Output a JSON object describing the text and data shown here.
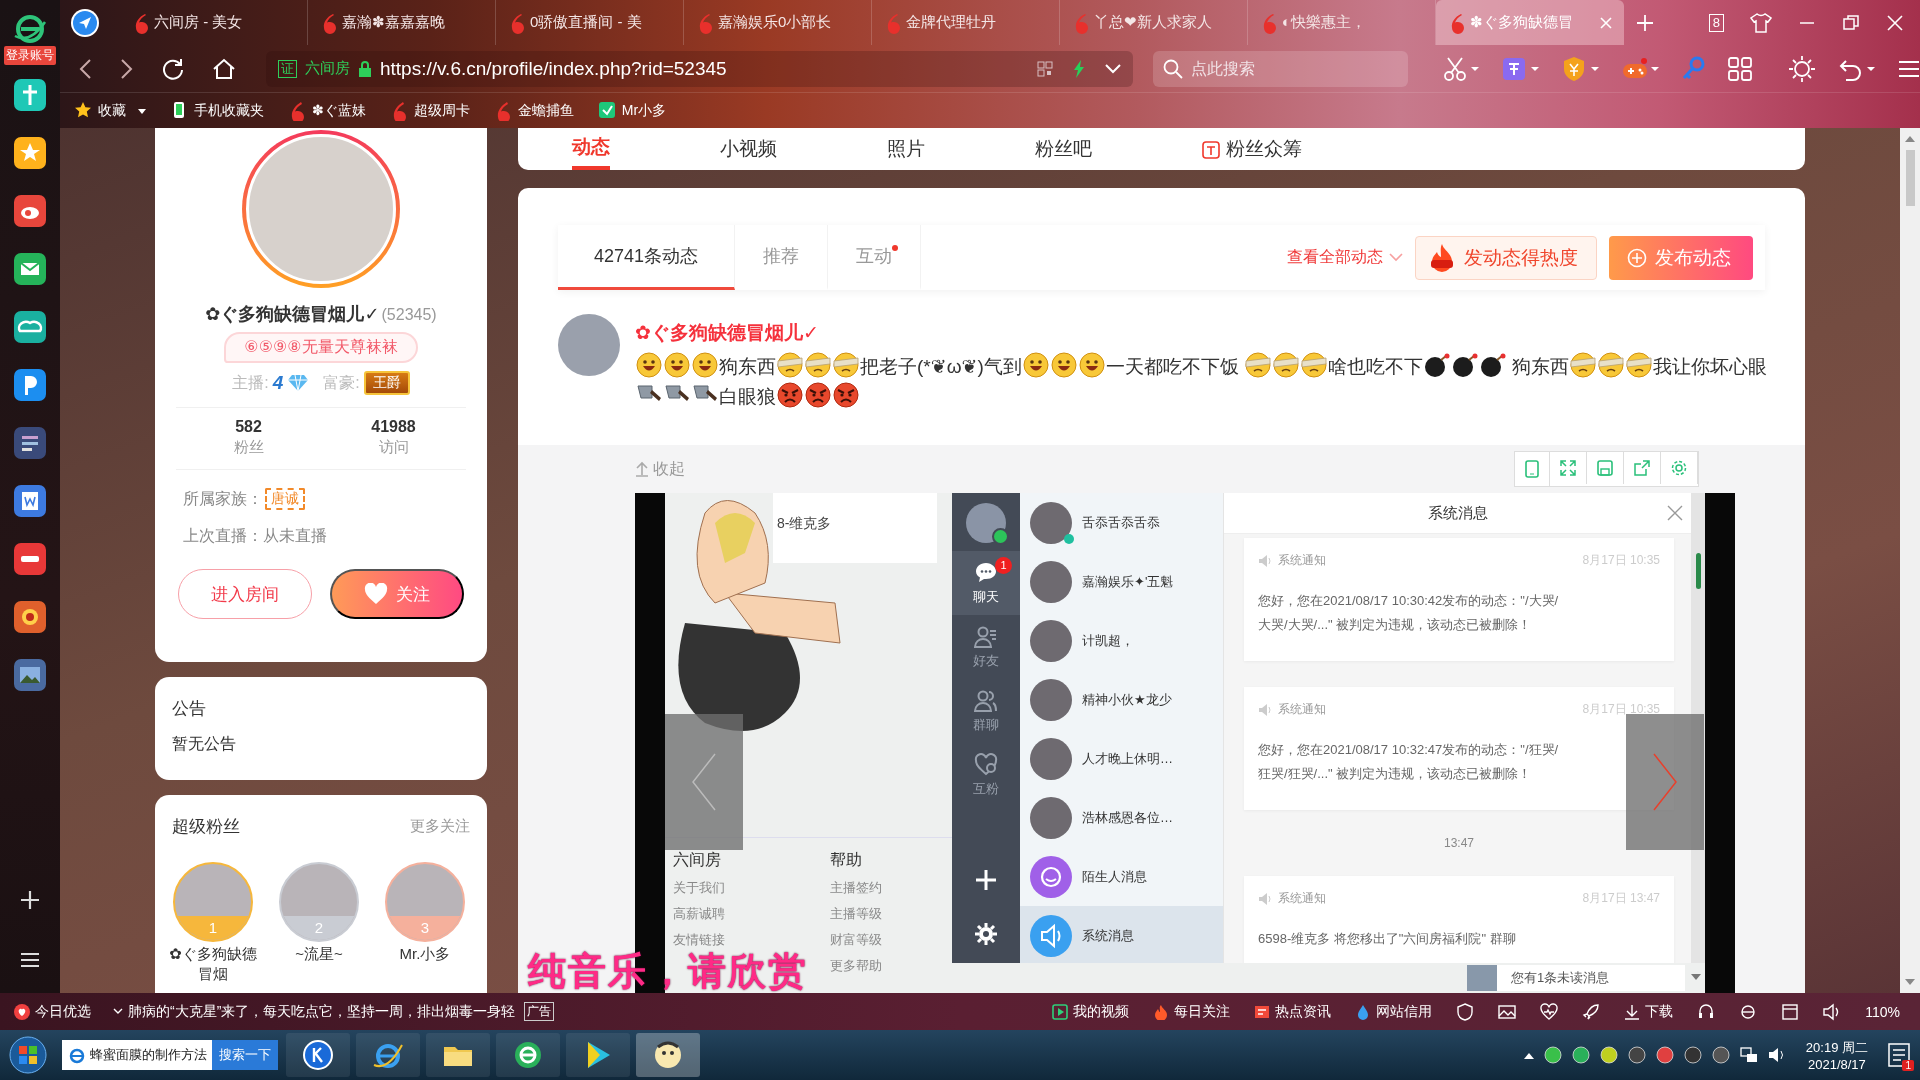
{
  "browser": {
    "login_label": "登录账号",
    "tabs": [
      {
        "title": "六间房 - 美女",
        "selected": false
      },
      {
        "title": "嘉瀚✽嘉嘉嘉晚",
        "selected": false
      },
      {
        "title": "0骄傲直播间 - 美",
        "selected": false
      },
      {
        "title": "嘉瀚娱乐0小部长",
        "selected": false
      },
      {
        "title": "金牌代理牡丹",
        "selected": false
      },
      {
        "title": "丫总❤新人求家人",
        "selected": false
      },
      {
        "title": "◐快樂惠主，",
        "selected": false
      },
      {
        "title": "✽ぐ多狗缺德冒",
        "selected": true
      }
    ],
    "tab_count": "8",
    "address": {
      "cert_label": "证",
      "site_label": "六间房",
      "url": "https://v.6.cn/profile/index.php?rid=52345"
    },
    "search": {
      "placeholder": "点此搜索"
    },
    "bookmarks": [
      {
        "title": "收藏",
        "kind": "favorites"
      },
      {
        "title": "手机收藏夹",
        "kind": "phone"
      },
      {
        "title": "✽ぐ蓝妹",
        "kind": "site"
      },
      {
        "title": "超级周卡",
        "kind": "site"
      },
      {
        "title": "金蟾捕鱼",
        "kind": "site"
      },
      {
        "title": "Mr小多",
        "kind": "app"
      }
    ]
  },
  "site_nav": [
    {
      "label": "动态",
      "selected": true
    },
    {
      "label": "小视频",
      "selected": false
    },
    {
      "label": "照片",
      "selected": false
    },
    {
      "label": "粉丝吧",
      "selected": false
    },
    {
      "label": "粉丝众筹",
      "selected": false
    }
  ],
  "profile": {
    "name": "✿ぐ多狗缺德冒烟儿✓",
    "rid": "(52345)",
    "signature": "⑥⑤⑨⑧无量天尊袜袜",
    "anchor_label": "主播:",
    "anchor_level": "4",
    "rich_label": "富豪:",
    "rich_badge": "王爵",
    "stats": [
      {
        "value": "582",
        "label": "粉丝"
      },
      {
        "value": "41988",
        "label": "访问"
      }
    ],
    "family_label": "所属家族：",
    "family": "唐诚",
    "last_live": "上次直播：从未直播",
    "enter_button": "进入房间",
    "follow_button": "关注"
  },
  "notice": {
    "title": "公告",
    "text": "暂无公告"
  },
  "super_fans": {
    "title": "超级粉丝",
    "more": "更多关注",
    "fans": [
      {
        "rank": "1",
        "name": "✿ぐ多狗缺德冒烟",
        "color": "#f6b73c"
      },
      {
        "rank": "2",
        "name": "~流星~",
        "color": "#c9ccd3"
      },
      {
        "rank": "3",
        "name": "Mr.小多",
        "color": "#f5b09c"
      }
    ]
  },
  "feed": {
    "tabs": [
      {
        "label": "42741条动态",
        "selected": true,
        "dot": false
      },
      {
        "label": "推荐",
        "selected": false,
        "dot": false
      },
      {
        "label": "互动",
        "selected": false,
        "dot": true
      }
    ],
    "view_all": "查看全部动态",
    "hot_button": "发动态得热度",
    "publish_button": "发布动态",
    "post": {
      "author": "✿ぐ多狗缺德冒烟儿✓",
      "content": [
        {
          "kind": "grin"
        },
        {
          "kind": "grin"
        },
        {
          "kind": "grin"
        },
        {
          "kind": "text",
          "text": "狗东西"
        },
        {
          "kind": "bandage"
        },
        {
          "kind": "bandage"
        },
        {
          "kind": "bandage"
        },
        {
          "kind": "text",
          "text": "把老子(*❦ω❦)气到"
        },
        {
          "kind": "grin"
        },
        {
          "kind": "grin"
        },
        {
          "kind": "grin"
        },
        {
          "kind": "text",
          "text": "一天都吃不下饭 "
        },
        {
          "kind": "bandage"
        },
        {
          "kind": "bandage"
        },
        {
          "kind": "bandage"
        },
        {
          "kind": "text",
          "text": "啥也吃不下"
        },
        {
          "kind": "bomb"
        },
        {
          "kind": "bomb"
        },
        {
          "kind": "bomb"
        },
        {
          "kind": "text",
          "text": " 狗东西"
        },
        {
          "kind": "bandage"
        },
        {
          "kind": "bandage"
        },
        {
          "kind": "bandage"
        },
        {
          "kind": "text",
          "text": "我让你坏心眼"
        },
        {
          "kind": "cleaver"
        },
        {
          "kind": "cleaver"
        },
        {
          "kind": "cleaver"
        },
        {
          "kind": "text",
          "text": "白眼狼"
        },
        {
          "kind": "angry"
        },
        {
          "kind": "angry"
        },
        {
          "kind": "angry"
        }
      ]
    },
    "collapse": "收起",
    "screenshot": {
      "partial_name": "8-维克多",
      "footer": [
        {
          "title": "六间房",
          "links": [
            "关于我们",
            "高薪诚聘",
            "友情链接"
          ]
        },
        {
          "title": "帮助",
          "links": [
            "主播签约",
            "主播等级",
            "财富等级",
            "更多帮助"
          ]
        }
      ],
      "chat": {
        "nav": [
          {
            "label": "聊天",
            "badge": "1",
            "selected": true
          },
          {
            "label": "好友",
            "selected": false
          },
          {
            "label": "群聊",
            "selected": false
          },
          {
            "label": "互粉",
            "selected": false
          }
        ],
        "contacts": [
          {
            "name": "舌忝舌忝舌忝",
            "kind": "person",
            "online": true,
            "selected": false
          },
          {
            "name": "嘉瀚娱乐✦'五魁",
            "kind": "person",
            "online": false,
            "selected": false
          },
          {
            "name": "计凯超，",
            "kind": "person",
            "online": false,
            "selected": false
          },
          {
            "name": "精神小伙★龙少",
            "kind": "person",
            "online": false,
            "selected": false
          },
          {
            "name": "人才晚上休明…",
            "kind": "person",
            "online": false,
            "selected": false
          },
          {
            "name": "浩林感恩各位…",
            "kind": "person",
            "online": false,
            "selected": false
          },
          {
            "name": "陌生人消息",
            "kind": "strangers",
            "online": false,
            "selected": false
          },
          {
            "name": "系统消息",
            "kind": "system",
            "online": false,
            "selected": true
          }
        ],
        "title": "系统消息",
        "messages": [
          {
            "kind": "notice",
            "title": "系统通知",
            "time": "8月17日 10:35",
            "text": "您好，您在2021/08/17 10:30:42发布的动态：\"/大哭/大哭/大哭/...\" 被判定为违规，该动态已被删除！"
          },
          {
            "kind": "notice",
            "title": "系统通知",
            "time": "8月17日 10:35",
            "text": "您好，您在2021/08/17 10:32:47发布的动态：\"/狂哭/狂哭/狂哭/...\" 被判定为违规，该动态已被删除！"
          },
          {
            "kind": "time",
            "text": "13:47"
          },
          {
            "kind": "notice",
            "title": "系统通知",
            "time": "8月17日 13:47",
            "text": "6598-维克多 将您移出了\"六间房福利院\" 群聊"
          }
        ],
        "unread": "您有1条未读消息"
      }
    }
  },
  "lyrics": "纯音乐，请欣赏",
  "status_bar": {
    "picks": "今日优选",
    "ticker": "肺病的“大克星”来了，每天吃点它，坚持一周，排出烟毒一身轻",
    "ad_label": "广告",
    "links": [
      "我的视频",
      "每日关注",
      "热点资讯",
      "网站信用"
    ],
    "download": "下载",
    "zoom": "110%"
  },
  "taskbar": {
    "search_text": "蜂蜜面膜的制作方法",
    "search_button": "搜索一下",
    "time": "20:19 周二",
    "date": "2021/8/17",
    "notification_badge": "1"
  }
}
